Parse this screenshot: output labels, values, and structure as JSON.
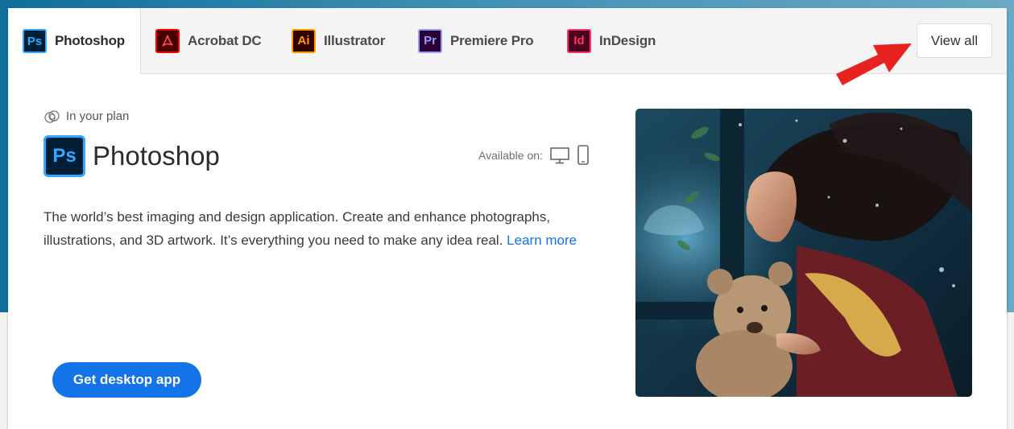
{
  "tabs": [
    {
      "label": "Photoshop",
      "abbr": "Ps",
      "bg": "#001e36",
      "fg": "#31a8ff",
      "active": true
    },
    {
      "label": "Acrobat DC",
      "abbr": "",
      "bg": "#470000",
      "fg": "#ff0000",
      "active": false
    },
    {
      "label": "Illustrator",
      "abbr": "Ai",
      "bg": "#330000",
      "fg": "#ff9a00",
      "active": false
    },
    {
      "label": "Premiere Pro",
      "abbr": "Pr",
      "bg": "#2a0034",
      "fg": "#9999ff",
      "active": false
    },
    {
      "label": "InDesign",
      "abbr": "Id",
      "bg": "#49021f",
      "fg": "#ff3366",
      "active": false
    }
  ],
  "view_all_label": "View all",
  "product": {
    "plan_label": "In your plan",
    "icon_abbr": "Ps",
    "name": "Photoshop",
    "available_label": "Available on:",
    "description": "The world’s best imaging and design application. Create and enhance photographs, illustrations, and 3D artwork. It’s everything you need to make any idea real.",
    "learn_more_label": "Learn more",
    "cta_label": "Get desktop app"
  },
  "colors": {
    "accent": "#1473e6",
    "annotation_arrow": "#e8231f"
  },
  "icons": [
    "creative-cloud-icon",
    "desktop-icon",
    "mobile-icon"
  ],
  "hero_image": "girl-with-teddy-bear-underwater-photo"
}
